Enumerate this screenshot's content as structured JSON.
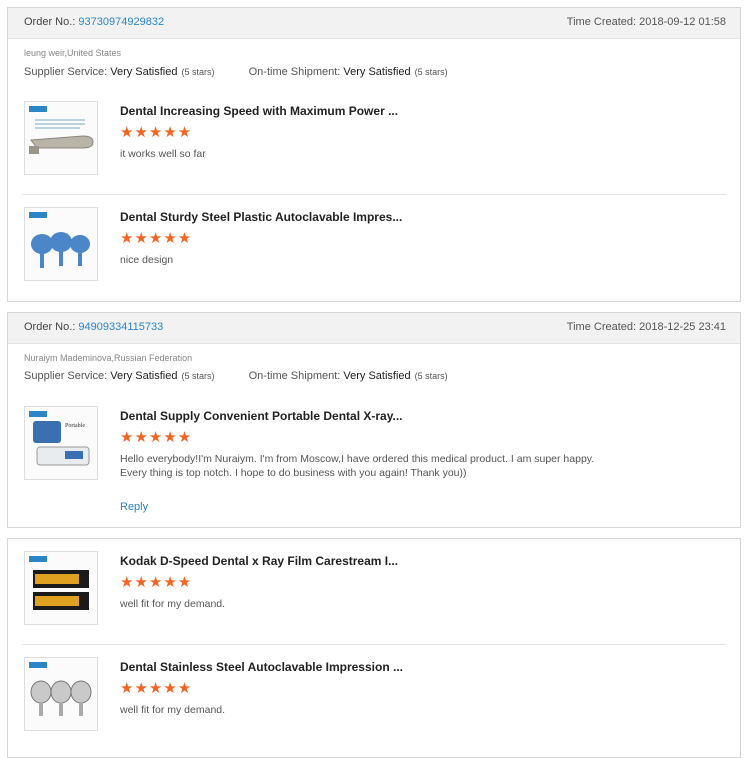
{
  "orders": [
    {
      "order_label": "Order No.:",
      "order_no": "93730974929832",
      "time_created": "Time Created: 2018-09-12 01:58",
      "buyer": "leung weir,United States",
      "supplier_label": "Supplier Service:",
      "supplier_value": "Very Satisfied",
      "supplier_stars": "(5 stars)",
      "shipment_label": "On-time Shipment:",
      "shipment_value": "Very Satisfied",
      "shipment_stars": "(5 stars)",
      "items": [
        {
          "title": "Dental Increasing Speed with Maximum Power ...",
          "rating": 5,
          "stars": "★★★★★",
          "comment": "it works well so far",
          "thumb_icon": "handpiece-icon"
        },
        {
          "title": "Dental Sturdy Steel Plastic Autoclavable Impres...",
          "rating": 5,
          "stars": "★★★★★",
          "comment": "nice design",
          "thumb_icon": "impression-tray-icon"
        }
      ]
    },
    {
      "order_label": "Order No.:",
      "order_no": "94909334115733",
      "time_created": "Time Created: 2018-12-25 23:41",
      "buyer": "Nuraiym Mademinova,Russian Federation",
      "supplier_label": "Supplier Service:",
      "supplier_value": "Very Satisfied",
      "supplier_stars": "(5 stars)",
      "shipment_label": "On-time Shipment:",
      "shipment_value": "Very Satisfied",
      "shipment_stars": "(5 stars)",
      "items": [
        {
          "title": "Dental Supply Convenient Portable Dental X-ray...",
          "rating": 5,
          "stars": "★★★★★",
          "comment": "Hello everybody!I'm Nuraiym. I'm from Moscow,I have ordered this medical product. I am super happy. Every thing is top notch. I hope to do business with you again! Thank you))",
          "reply": "Reply",
          "thumb_icon": "xray-unit-icon"
        }
      ]
    },
    {
      "items": [
        {
          "title": "Kodak D-Speed Dental x Ray Film Carestream I...",
          "rating": 5,
          "stars": "★★★★★",
          "comment": "well fit for my demand.",
          "thumb_icon": "film-box-icon"
        },
        {
          "title": "Dental Stainless Steel Autoclavable Impression ...",
          "rating": 5,
          "stars": "★★★★★",
          "comment": "well fit for my demand.",
          "thumb_icon": "steel-tray-icon"
        }
      ]
    }
  ],
  "colors": {
    "link": "#2c85c6",
    "star": "#f26522",
    "header_bg": "#f2f2f2"
  }
}
